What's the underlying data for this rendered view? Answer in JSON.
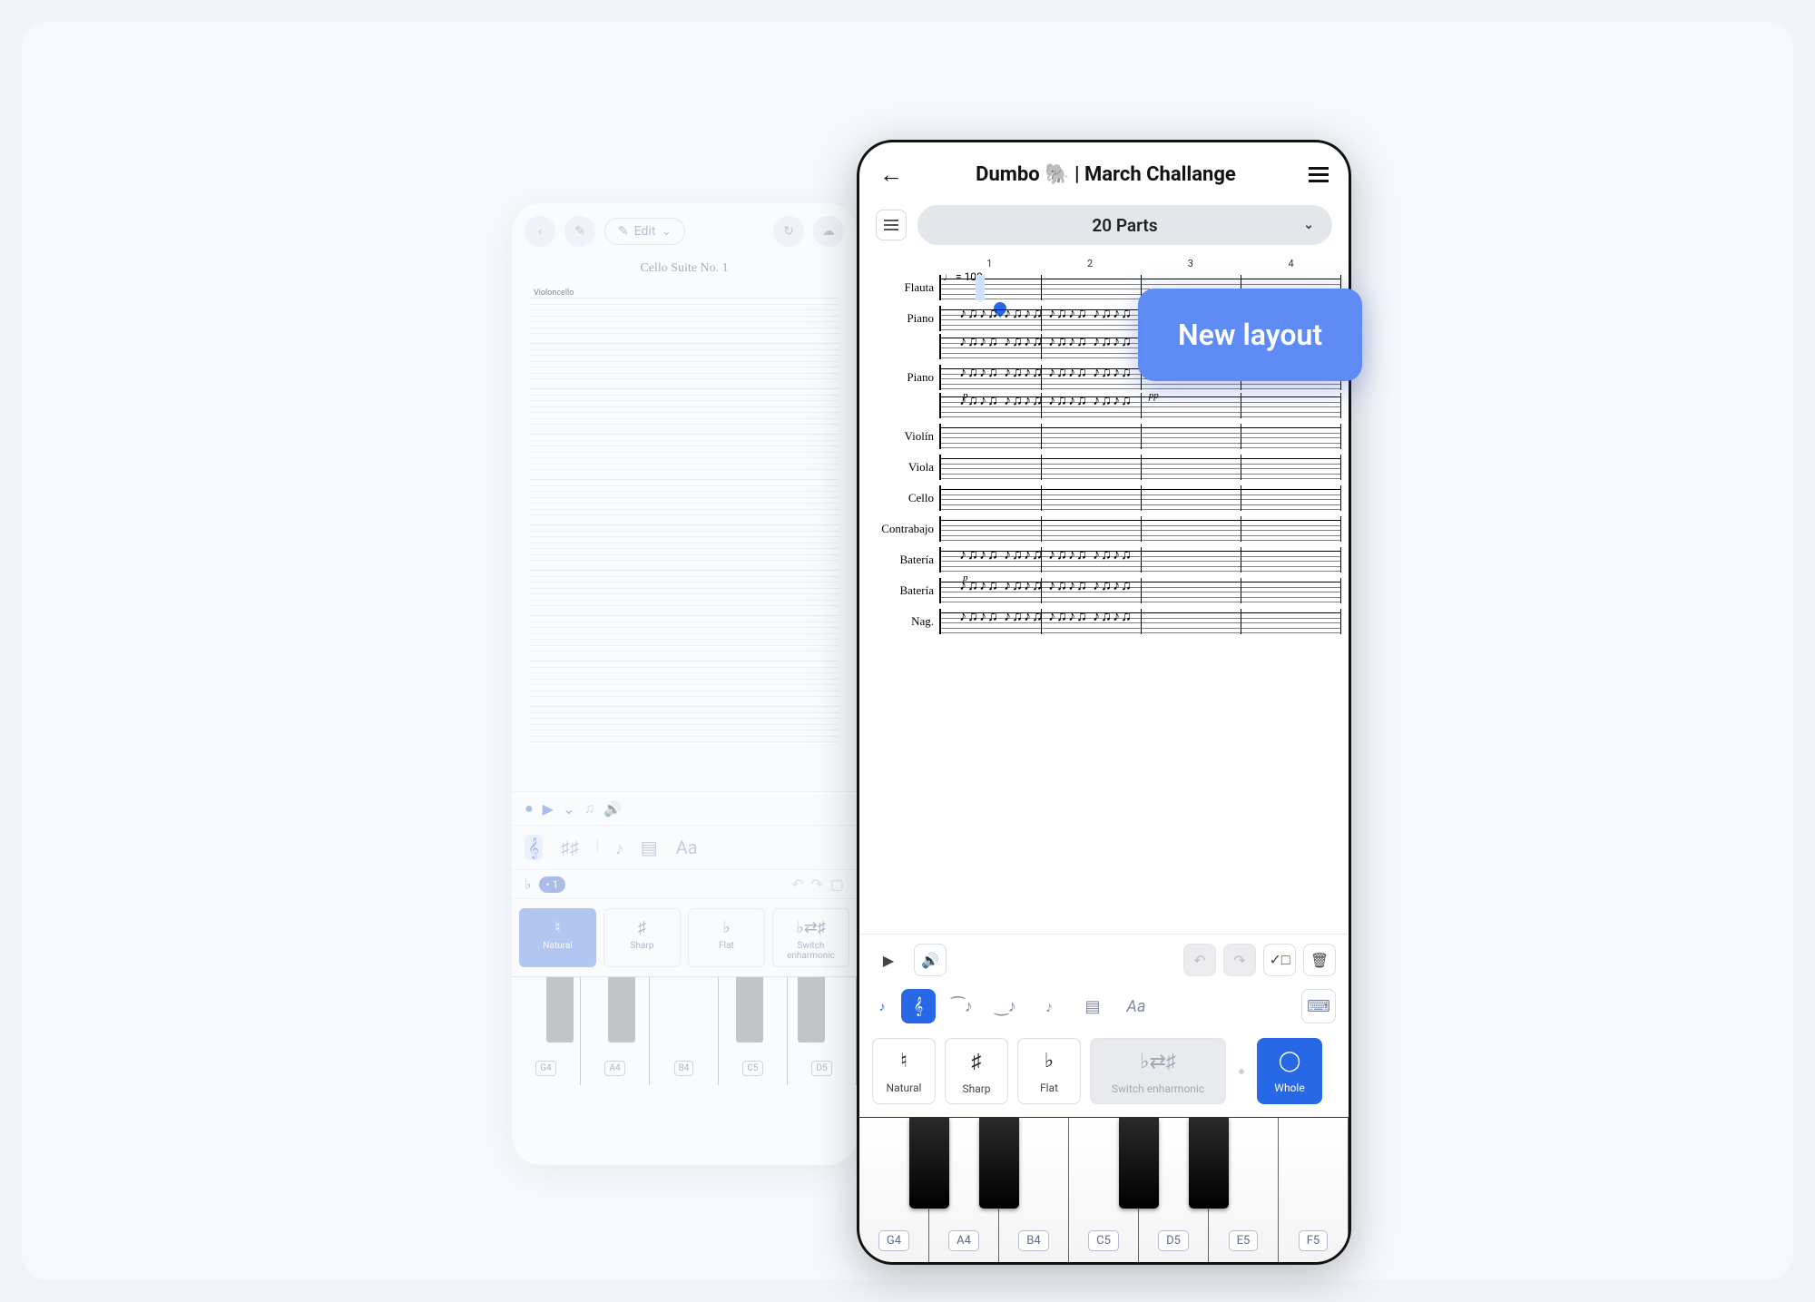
{
  "tooltip": {
    "label": "New layout"
  },
  "old_phone": {
    "edit_label": "Edit",
    "title": "Cello Suite No. 1",
    "instrument_label": "Violoncello",
    "accidentals": [
      {
        "symbol": "♮",
        "label": "Natural",
        "selected": true
      },
      {
        "symbol": "♯",
        "label": "Sharp"
      },
      {
        "symbol": "♭",
        "label": "Flat"
      },
      {
        "symbol": "♭⇄♯",
        "label": "Switch enharmonic"
      }
    ],
    "keys": [
      "G4",
      "A4",
      "B4",
      "C5",
      "D5"
    ]
  },
  "new_phone": {
    "title": "Dumbo 🐘 | March Challange",
    "parts_label": "20 Parts",
    "measures": [
      "1",
      "2",
      "3",
      "4"
    ],
    "tempo": "= 100",
    "instruments": [
      {
        "label": "Flauta",
        "staves": 1,
        "cursor": true,
        "dyn": ""
      },
      {
        "label": "Piano",
        "staves": 2,
        "notes": true,
        "dyn": ""
      },
      {
        "label": "Piano",
        "staves": 2,
        "notes": true,
        "dyn": "p",
        "dyn2": "pp"
      },
      {
        "label": "Violín",
        "staves": 1
      },
      {
        "label": "Viola",
        "staves": 1
      },
      {
        "label": "Cello",
        "staves": 1
      },
      {
        "label": "Contrabajo",
        "staves": 1
      },
      {
        "label": "Batería",
        "staves": 1,
        "notes": true,
        "dyn": "p"
      },
      {
        "label": "Batería",
        "staves": 1,
        "notes": true
      },
      {
        "label": "Nag.",
        "staves": 1,
        "notes": true
      }
    ],
    "accidentals": [
      {
        "symbol": "♮",
        "label": "Natural"
      },
      {
        "symbol": "♯",
        "label": "Sharp"
      },
      {
        "symbol": "♭",
        "label": "Flat"
      },
      {
        "symbol": "♭⇄♯",
        "label": "Switch enharmonic",
        "disabled": true
      },
      {
        "symbol": "◯",
        "label": "Whole",
        "whole": true
      }
    ],
    "keys": [
      "G4",
      "A4",
      "B4",
      "C5",
      "D5",
      "E5",
      "F5"
    ]
  }
}
